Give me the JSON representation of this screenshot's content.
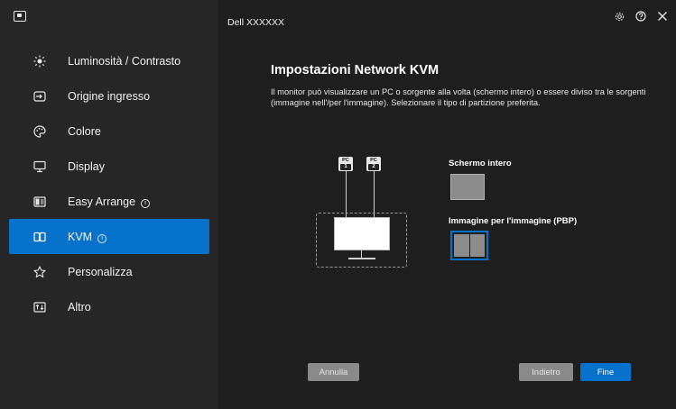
{
  "window": {
    "title": "Dell XXXXXX"
  },
  "sidebar": {
    "items": [
      {
        "label": "Luminosità / Contrasto",
        "icon": "brightness-icon",
        "info": false
      },
      {
        "label": "Origine ingresso",
        "icon": "input-source-icon",
        "info": false
      },
      {
        "label": "Colore",
        "icon": "color-palette-icon",
        "info": false
      },
      {
        "label": "Display",
        "icon": "display-icon",
        "info": false
      },
      {
        "label": "Easy Arrange",
        "icon": "easy-arrange-icon",
        "info": true
      },
      {
        "label": "KVM",
        "icon": "kvm-icon",
        "info": true
      },
      {
        "label": "Personalizza",
        "icon": "star-icon",
        "info": false
      },
      {
        "label": "Altro",
        "icon": "other-icon",
        "info": false
      }
    ],
    "active_index": 5
  },
  "main": {
    "title": "Impostazioni Network KVM",
    "description": "Il monitor può visualizzare un PC o sorgente alla volta (schermo intero) o essere diviso tra le sorgenti (immagine nell'/per l'immagine). Selezionare il tipo di partizione preferita.",
    "pc_tags": [
      {
        "label": "PC",
        "num": "1"
      },
      {
        "label": "PC",
        "num": "2"
      }
    ],
    "options": [
      {
        "label": "Schermo intero",
        "selected": false
      },
      {
        "label": "Immagine per l'immagine (PBP)",
        "selected": true
      }
    ],
    "buttons": {
      "cancel": "Annulla",
      "back": "Indietro",
      "finish": "Fine"
    }
  },
  "colors": {
    "accent": "#0672cb",
    "sidebar_bg": "#262626",
    "main_bg": "#1e1e1e"
  }
}
